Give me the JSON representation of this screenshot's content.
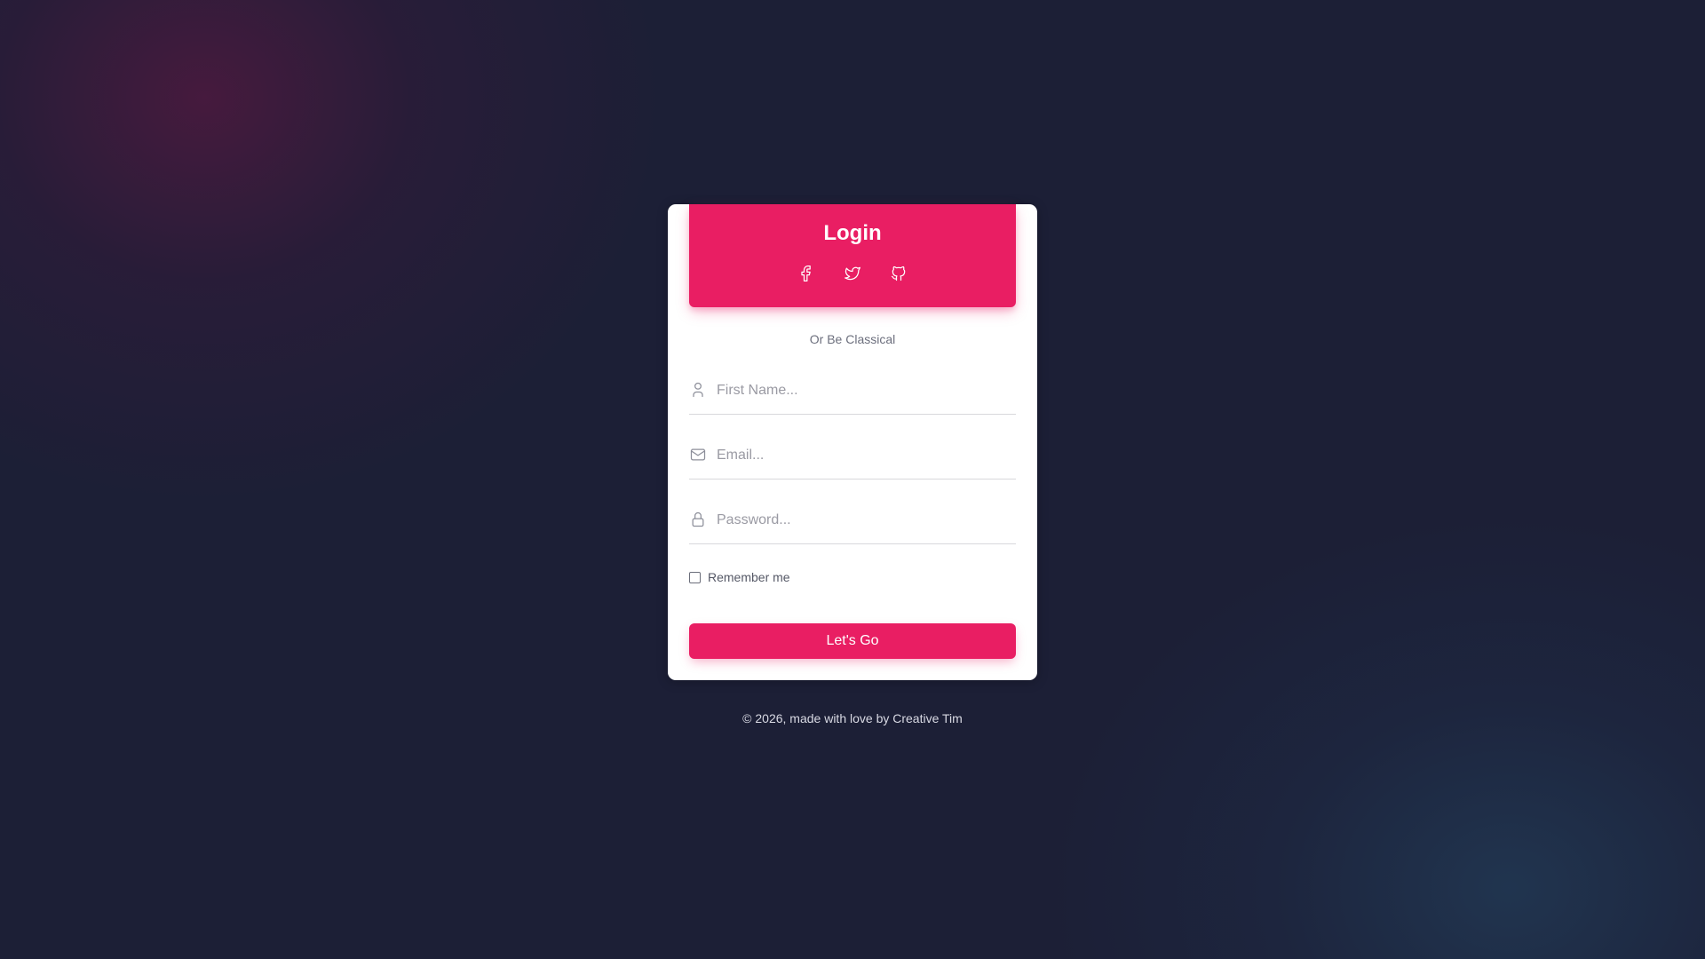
{
  "theme": {
    "accent": "#e91e63",
    "background": "#1c1f36",
    "card": "#ffffff"
  },
  "header": {
    "title": "Login",
    "social": [
      {
        "name": "facebook",
        "icon": "facebook-icon"
      },
      {
        "name": "twitter",
        "icon": "twitter-icon"
      },
      {
        "name": "github",
        "icon": "github-icon"
      }
    ]
  },
  "form": {
    "subtitle": "Or Be Classical",
    "first_name": {
      "placeholder": "First Name...",
      "value": "",
      "icon": "user-icon"
    },
    "email": {
      "placeholder": "Email...",
      "value": "",
      "icon": "mail-icon"
    },
    "password": {
      "placeholder": "Password...",
      "value": "",
      "icon": "lock-icon"
    },
    "remember_label": "Remember me",
    "remember_checked": false,
    "submit_label": "Let's Go"
  },
  "footer": {
    "prefix": "© 2026, made with love by ",
    "link_text": "Creative Tim"
  }
}
